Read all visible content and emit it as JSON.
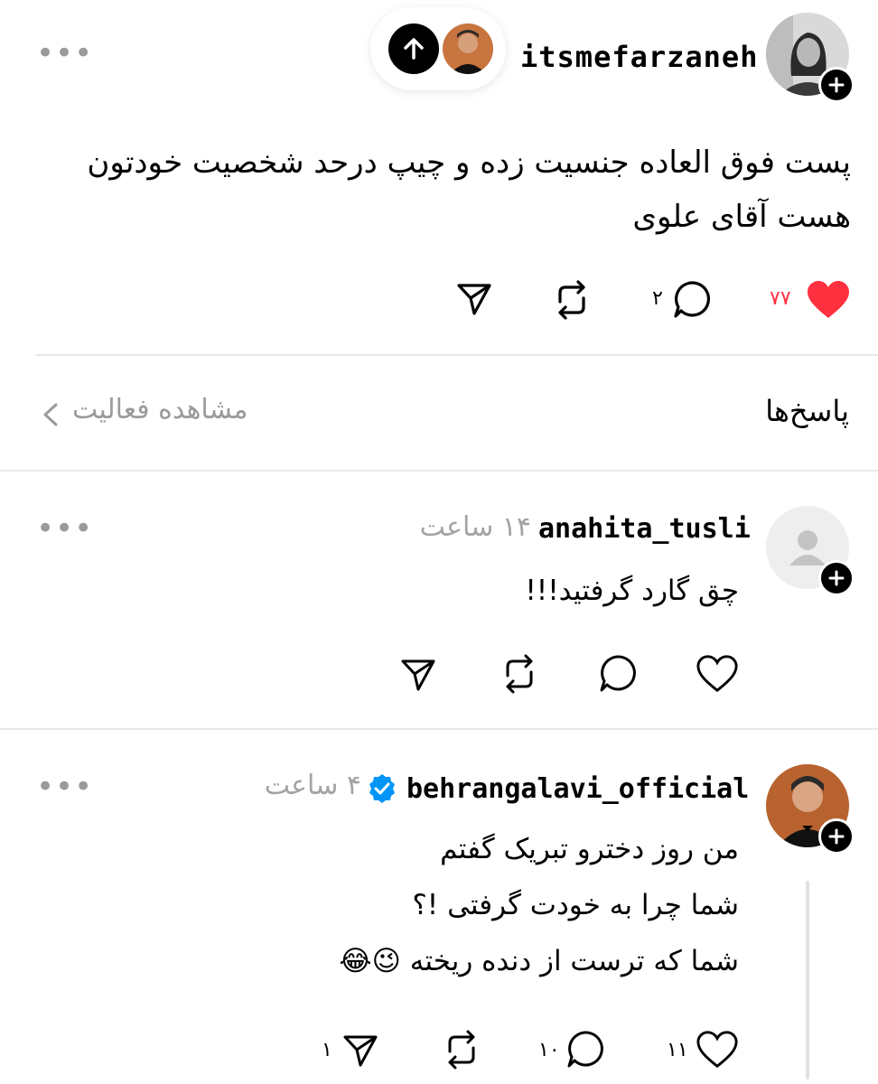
{
  "post": {
    "author": "itsmefarzaneh",
    "text": "پست فوق العاده جنسیت زده و چیپ درحد شخصیت خودتون هست آقای علوی",
    "likes": "۷۷",
    "comments": "۲"
  },
  "replies_header": {
    "title": "پاسخ‌ها",
    "view_activity": "مشاهده فعالیت"
  },
  "replies": [
    {
      "author": "anahita_tusli",
      "time": "۱۴ ساعت",
      "text": "چق گارد گرفتید!!!"
    },
    {
      "author": "behrangalavi_official",
      "time": "۴ ساعت",
      "verified": true,
      "lines": [
        "من روز دخترو تبریک گفتم",
        "شما چرا به خودت گرفتی !؟",
        "شما که ترست از دنده ریخته 😉😂"
      ],
      "likes": "۱۱",
      "comments": "۱۰",
      "shares": "۱"
    }
  ],
  "colors": {
    "like_red": "#ff3040",
    "verified_blue": "#0095f6",
    "muted": "#9a9a9a"
  }
}
